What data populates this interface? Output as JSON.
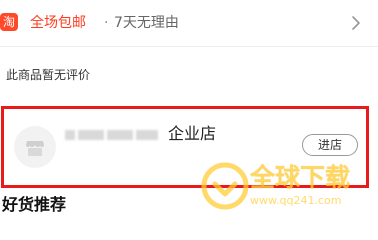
{
  "service": {
    "icon_name": "taobao-icon",
    "icon_glyph": "淘",
    "icon_color": "#ff4a2a",
    "free_shipping": "全场包邮",
    "separator": "·",
    "return_policy": "7天无理由",
    "arrow_icon": "chevron-right-icon"
  },
  "reviews": {
    "empty_text": "此商品暂无评价"
  },
  "shop": {
    "name_suffix": "企业店",
    "enter_label": "进店",
    "logo_icon": "store-icon",
    "highlight_color": "#e81a1a"
  },
  "recommend": {
    "title": "好货推荐"
  },
  "watermark": {
    "text": "全球下载",
    "url": "www.qq241.com",
    "color": "#ffcc33"
  }
}
